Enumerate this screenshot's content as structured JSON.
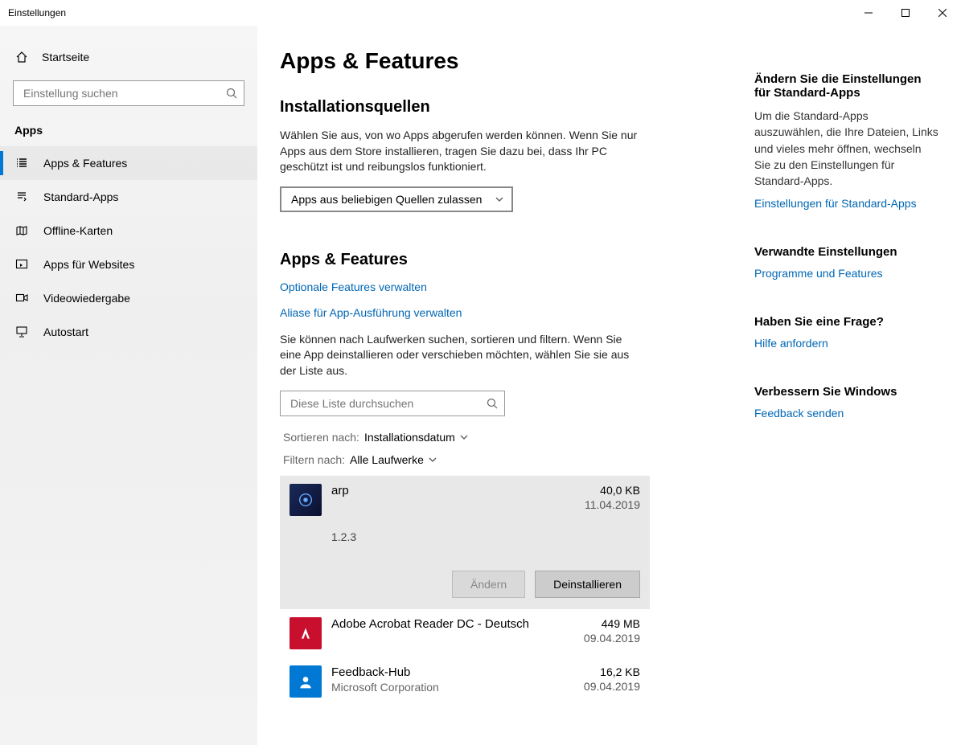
{
  "window_title": "Einstellungen",
  "home_label": "Startseite",
  "search_placeholder": "Einstellung suchen",
  "sidebar_heading": "Apps",
  "nav": [
    {
      "label": "Apps & Features"
    },
    {
      "label": "Standard-Apps"
    },
    {
      "label": "Offline-Karten"
    },
    {
      "label": "Apps für Websites"
    },
    {
      "label": "Videowiedergabe"
    },
    {
      "label": "Autostart"
    }
  ],
  "page_title": "Apps & Features",
  "sources_heading": "Installationsquellen",
  "sources_text": "Wählen Sie aus, von wo Apps abgerufen werden können. Wenn Sie nur Apps aus dem Store installieren, tragen Sie dazu bei, dass Ihr PC geschützt ist und reibungslos funktioniert.",
  "sources_dropdown": "Apps aus beliebigen Quellen zulassen",
  "af_heading": "Apps & Features",
  "optional_link": "Optionale Features verwalten",
  "alias_link": "Aliase für App-Ausführung verwalten",
  "af_text": "Sie können nach Laufwerken suchen, sortieren und filtern. Wenn Sie eine App deinstallieren oder verschieben möchten, wählen Sie sie aus der Liste aus.",
  "list_search_placeholder": "Diese Liste durchsuchen",
  "sort_label": "Sortieren nach:",
  "sort_value": "Installationsdatum",
  "filter_label": "Filtern nach:",
  "filter_value": "Alle Laufwerke",
  "apps": [
    {
      "name": "arp",
      "version": "1.2.3",
      "size": "40,0 KB",
      "date": "11.04.2019",
      "publisher": ""
    },
    {
      "name": "Adobe Acrobat Reader DC - Deutsch",
      "size": "449 MB",
      "date": "09.04.2019",
      "publisher": ""
    },
    {
      "name": "Feedback-Hub",
      "publisher": "Microsoft Corporation",
      "size": "16,2 KB",
      "date": "09.04.2019"
    }
  ],
  "btn_modify": "Ändern",
  "btn_uninstall": "Deinstallieren",
  "rp": {
    "defaults_title": "Ändern Sie die Einstellungen für Standard-Apps",
    "defaults_text": "Um die Standard-Apps auszuwählen, die Ihre Dateien, Links und vieles mehr öffnen, wechseln Sie zu den Einstellungen für Standard-Apps.",
    "defaults_link": "Einstellungen für Standard-Apps",
    "related_title": "Verwandte Einstellungen",
    "related_link": "Programme und Features",
    "question_title": "Haben Sie eine Frage?",
    "question_link": "Hilfe anfordern",
    "improve_title": "Verbessern Sie Windows",
    "improve_link": "Feedback senden"
  }
}
